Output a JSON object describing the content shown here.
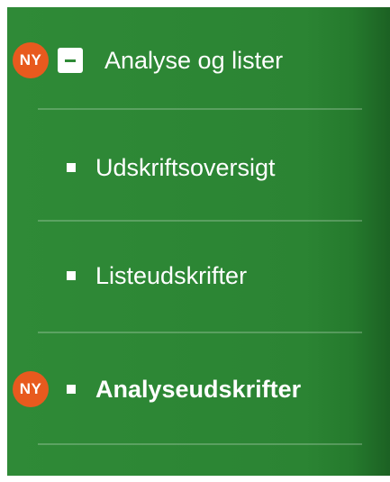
{
  "menu": {
    "parent": {
      "badge": "NY",
      "label": "Analyse og lister",
      "expanded": true
    },
    "items": [
      {
        "label": "Udskriftsoversigt",
        "badge": "",
        "active": false
      },
      {
        "label": "Listeudskrifter",
        "badge": "",
        "active": false
      },
      {
        "label": "Analyseudskrifter",
        "badge": "NY",
        "active": true
      }
    ]
  },
  "colors": {
    "background": "#2b8433",
    "badge": "#e85a1e",
    "text": "#ffffff"
  }
}
